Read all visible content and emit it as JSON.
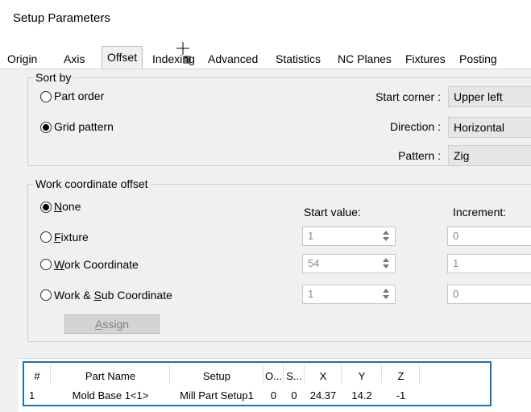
{
  "window": {
    "title": "Setup Parameters"
  },
  "tabs": [
    "Origin",
    "Axis",
    "Offset",
    "Indexing",
    "Advanced",
    "Statistics",
    "NC Planes",
    "Fixtures",
    "Posting"
  ],
  "active_tab": "Offset",
  "sort_by": {
    "legend": "Sort by",
    "part_order": "Part order",
    "grid_pattern": "Grid pattern",
    "selected": "Grid pattern",
    "start_corner_label": "Start corner :",
    "start_corner_value": "Upper left",
    "direction_label": "Direction :",
    "direction_value": "Horizontal",
    "pattern_label": "Pattern :",
    "pattern_value": "Zig"
  },
  "work_offset": {
    "legend": "Work coordinate offset",
    "start_value_label": "Start value:",
    "increment_label": "Increment:",
    "none_key": "N",
    "none_rest": "one",
    "fixture_key": "F",
    "fixture_rest": "ixture",
    "workcoord_key": "W",
    "workcoord_rest": "ork Coordinate",
    "worksub_pre": "Work & ",
    "worksub_key": "S",
    "worksub_rest": "ub Coordinate",
    "selected": "None",
    "fixture_start": "1",
    "fixture_inc": "0",
    "workcoord_start": "54",
    "workcoord_inc": "1",
    "worksub_start": "1",
    "worksub_inc": "0",
    "assign_key": "A",
    "assign_rest": "ssign"
  },
  "table": {
    "headers": [
      "#",
      "Part Name",
      "Setup",
      "O...",
      "S...",
      "X",
      "Y",
      "Z"
    ],
    "rows": [
      [
        "1",
        "Mold Base 1<1>",
        "Mill Part Setup1",
        "0",
        "0",
        "24.37",
        "14.2",
        "-1"
      ]
    ]
  },
  "colors": {
    "highlight_border": "#1a73b5",
    "selected_tab_bg": "#f0f0f0"
  }
}
